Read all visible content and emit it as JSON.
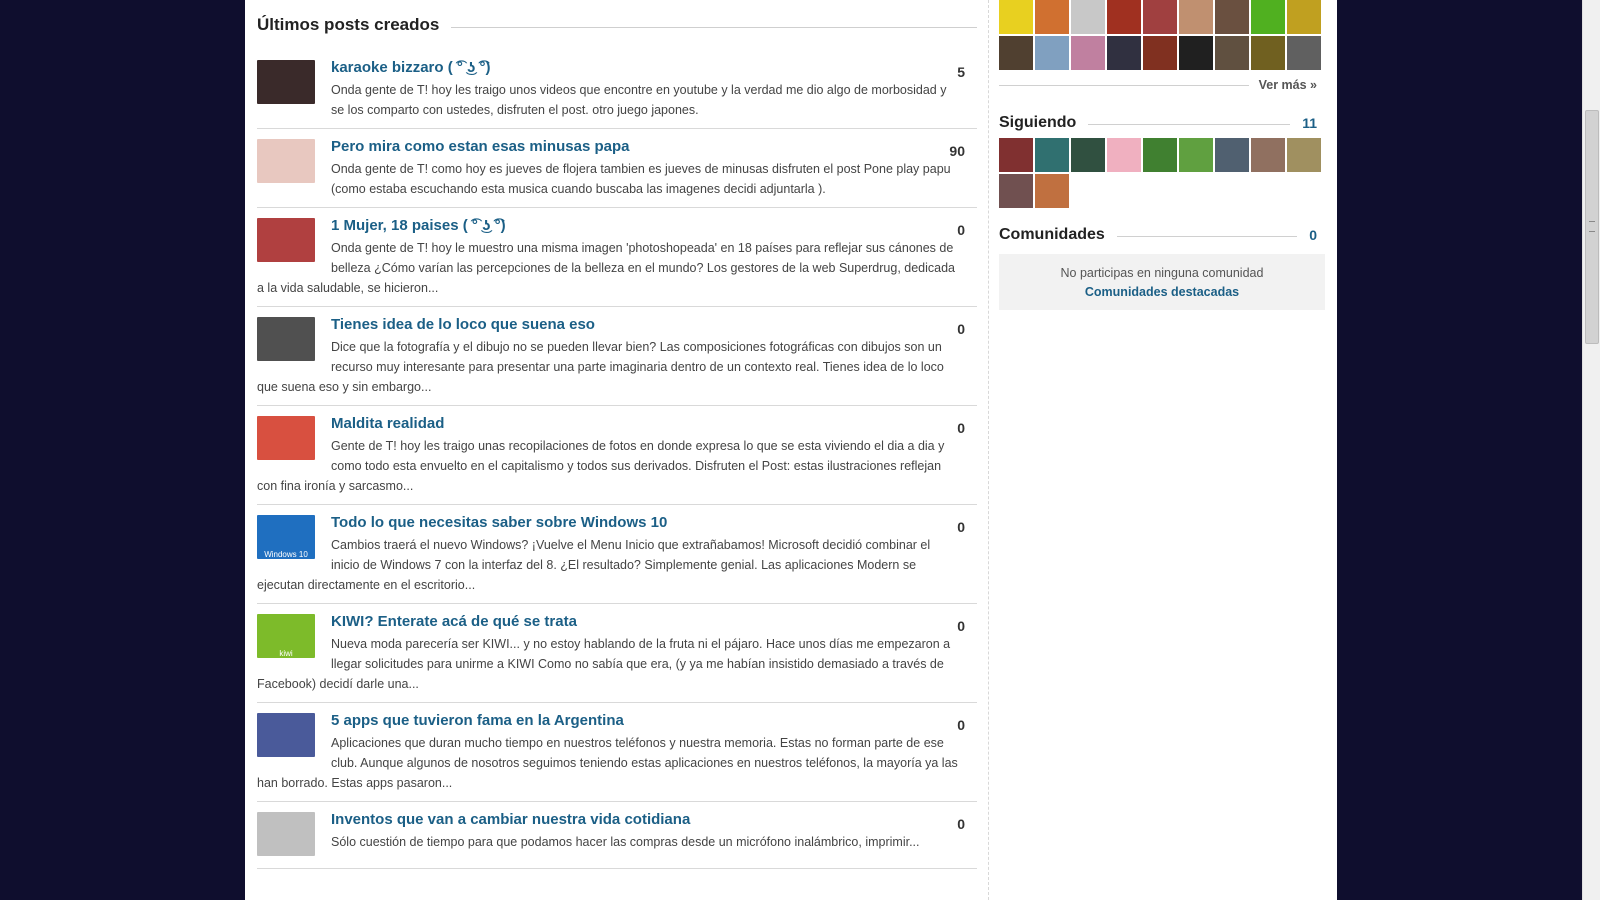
{
  "main": {
    "section_title": "Últimos posts creados",
    "posts": [
      {
        "title": "karaoke bizzaro ( ͡° ͜ʖ ͡°)",
        "count": "5",
        "desc": "Onda gente de T! hoy les traigo unos videos que encontre en youtube y la verdad me dio algo de morbosidad y se los comparto con ustedes, disfruten el post. otro juego japones."
      },
      {
        "title": "Pero mira como estan esas minusas  papa",
        "count": "90",
        "desc": "Onda gente de T! como hoy es jueves de flojera tambien es jueves de minusas disfruten el post Pone play papu (como estaba escuchando esta musica cuando buscaba las imagenes decidi adjuntarla )."
      },
      {
        "title": "1 Mujer, 18 paises ( ͡° ͜ʖ ͡°)",
        "count": "0",
        "desc": "Onda gente de T! hoy le muestro una misma imagen 'photoshopeada' en 18 países para reflejar sus cánones de belleza ¿Cómo varían las percepciones de la belleza en el mundo? Los gestores de la web Superdrug, dedicada a la vida saludable, se hicieron..."
      },
      {
        "title": "Tienes idea de lo loco que suena eso",
        "count": "0",
        "desc": "Dice que la fotografía y el dibujo no se pueden llevar bien? Las composiciones fotográficas con dibujos son un recurso muy interesante para presentar una parte imaginaria dentro de un contexto real. Tienes idea de lo loco que suena eso y sin embargo..."
      },
      {
        "title": "Maldita realidad",
        "count": "0",
        "desc": "Gente de T! hoy les traigo unas recopilaciones de fotos en donde expresa lo que se esta viviendo el dia a dia y como todo esta envuelto en el capitalismo y todos sus derivados. Disfruten el Post: estas ilustraciones reflejan con fina ironía y sarcasmo..."
      },
      {
        "title": "Todo lo que necesitas saber sobre Windows 10",
        "count": "0",
        "desc": "Cambios traerá el nuevo Windows? ¡Vuelve el Menu Inicio que extrañabamos! Microsoft decidió combinar el inicio de Windows 7 con la interfaz del 8. ¿El resultado? Simplemente genial. Las aplicaciones Modern se ejecutan directamente en el escritorio..."
      },
      {
        "title": "KIWI? Enterate acá de qué se trata",
        "count": "0",
        "desc": "Nueva moda parecería ser KIWI... y no estoy hablando de la fruta ni el pájaro. Hace unos días me empezaron a llegar solicitudes para unirme a KIWI Como no sabía que era, (y ya me habían insistido demasiado a través de Facebook) decidí darle una..."
      },
      {
        "title": "5 apps que tuvieron fama en la Argentina",
        "count": "0",
        "desc": "Aplicaciones que duran mucho tiempo en nuestros teléfonos y nuestra memoria. Estas no forman parte de ese club. Aunque algunos de nosotros seguimos teniendo estas aplicaciones en nuestros teléfonos, la mayoría ya las han borrado. Estas apps pasaron..."
      },
      {
        "title": "Inventos que van a cambiar nuestra vida cotidiana",
        "count": "0",
        "desc": "Sólo cuestión de tiempo para que podamos hacer las compras desde un micrófono inalámbrico, imprimir..."
      }
    ],
    "thumb_colors": [
      "#3a2a2a",
      "#e8c8c0",
      "#b04040",
      "#505050",
      "#d85040",
      "#1f6fc0",
      "#7dbb2a",
      "#4a5a9a",
      "#c0c0c0"
    ],
    "thumb_labels": [
      "",
      "",
      "",
      "",
      "",
      "Windows 10",
      "kiwi",
      "",
      ""
    ]
  },
  "sidebar": {
    "ver_mas": "Ver más »",
    "top_avatar_colors": [
      "#e8d020",
      "#d07030",
      "#c8c8c8",
      "#a03020",
      "#a04040",
      "#c09070",
      "#6a5040",
      "#50b020",
      "#c0a020",
      "#504030",
      "#80a0c0",
      "#c080a0",
      "#303040",
      "#803020",
      "#202020",
      "#605040",
      "#706020",
      "#606060"
    ],
    "siguiendo": {
      "title": "Siguiendo",
      "count": "11"
    },
    "siguiendo_colors": [
      "#803030",
      "#307070",
      "#305040",
      "#f0b0c0",
      "#408030",
      "#60a040",
      "#506070",
      "#907060",
      "#a09060",
      "#705050",
      "#c07040"
    ],
    "comunidades": {
      "title": "Comunidades",
      "count": "0",
      "empty_text": "No participas en ninguna comunidad",
      "link": "Comunidades destacadas"
    }
  },
  "colors": {
    "link": "#1b5f86",
    "background": "#0f0e2e"
  }
}
